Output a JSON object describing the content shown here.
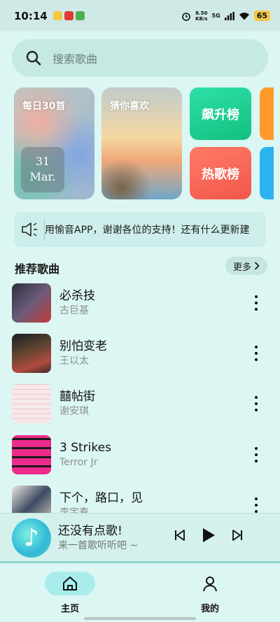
{
  "status_bar": {
    "time": "10:14",
    "net_speed_value": "8.50",
    "net_speed_unit": "KB/s",
    "signal_label": "5G",
    "battery": "65"
  },
  "search": {
    "placeholder": "搜索歌曲"
  },
  "cards": {
    "daily": {
      "label": "每日30首",
      "date_day": "31",
      "date_month": "Mar."
    },
    "guess": {
      "label": "猜你喜欢"
    },
    "rising": {
      "label": "飙升榜"
    },
    "hot": {
      "label": "热歌榜"
    }
  },
  "notice": {
    "text": "用愉音APP，谢谢各位的支持！还有什么更新建"
  },
  "section": {
    "title": "推荐歌曲",
    "more": "更多"
  },
  "songs": [
    {
      "title": "必杀技",
      "artist": "古巨基"
    },
    {
      "title": "别怕变老",
      "artist": "王以太"
    },
    {
      "title": "囍帖街",
      "artist": "谢安琪"
    },
    {
      "title": "3 Strikes",
      "artist": "Terror Jr"
    },
    {
      "title": "下个，路口，见",
      "artist": "李宇春"
    }
  ],
  "player": {
    "title": "还没有点歌!",
    "subtitle": "来一首歌听听吧 ~"
  },
  "nav": {
    "home": "主页",
    "mine": "我的"
  },
  "colors": {
    "accent": "#a9ecec",
    "background": "#dcf6f3",
    "rising": "#1fd08f",
    "hot": "#f5604f"
  }
}
